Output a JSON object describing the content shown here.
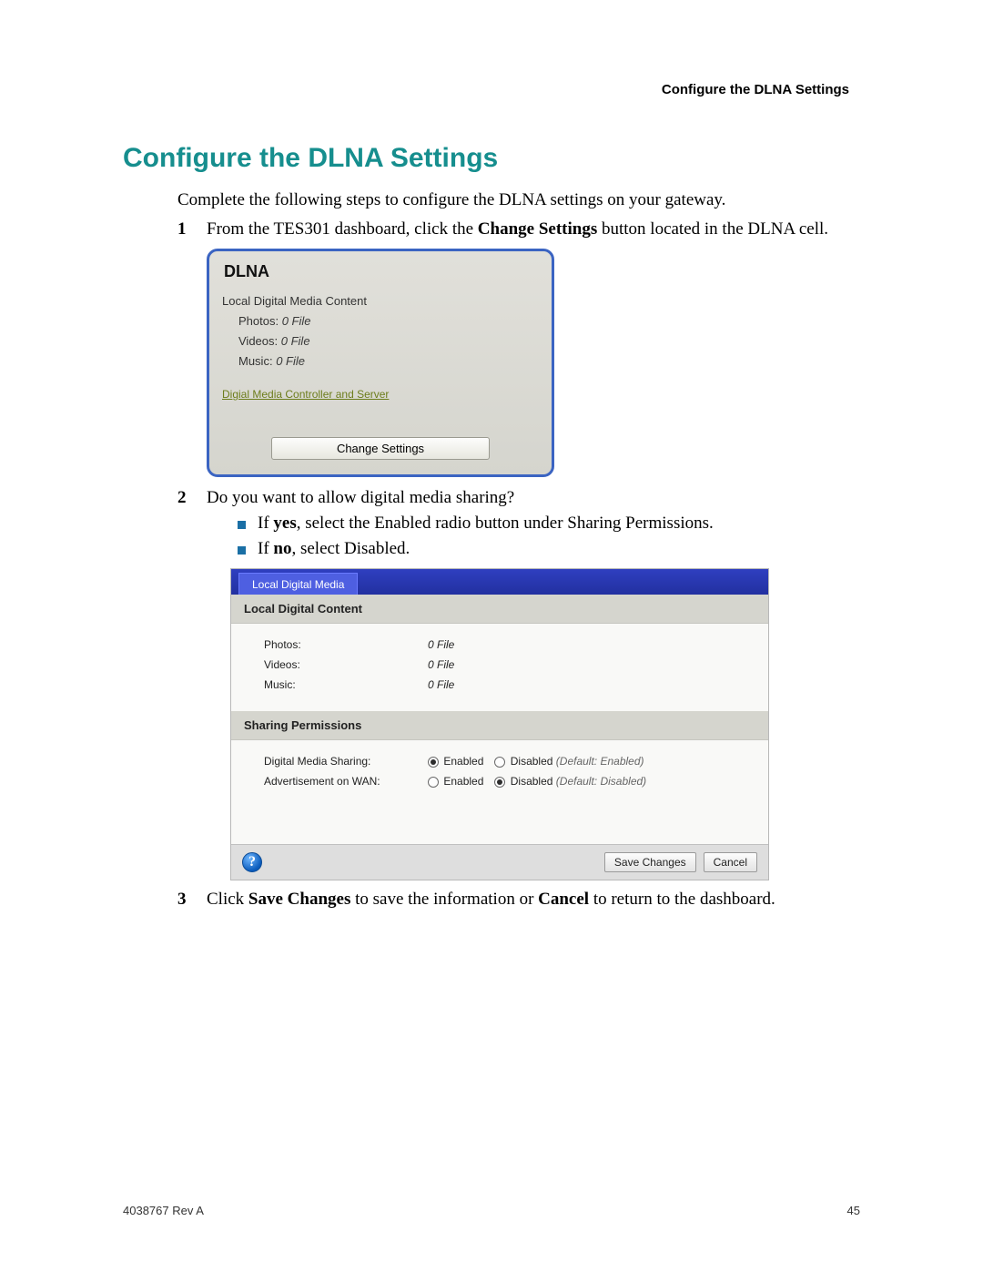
{
  "header": {
    "running": "Configure the DLNA Settings"
  },
  "title": "Configure the DLNA Settings",
  "intro": "Complete the following steps to configure the DLNA settings on your gateway.",
  "steps": {
    "s1a": "From the TES301 dashboard, click the ",
    "s1b": "Change Settings",
    "s1c": " button located in the DLNA cell.",
    "s2": "Do you want to allow digital media sharing?",
    "s2_yes_a": "If ",
    "s2_yes_b": "yes",
    "s2_yes_c": ", select the Enabled radio button under Sharing Permissions.",
    "s2_no_a": "If ",
    "s2_no_b": "no",
    "s2_no_c": ", select Disabled.",
    "s3a": "Click ",
    "s3b": "Save Changes",
    "s3c": " to save the information or ",
    "s3d": "Cancel",
    "s3e": " to return to the dashboard."
  },
  "card": {
    "title": "DLNA",
    "subtitle": "Local Digital Media Content",
    "rows": {
      "photos_label": "Photos:",
      "photos_value": "0 File",
      "videos_label": "Videos:",
      "videos_value": "0 File",
      "music_label": "Music:",
      "music_value": "0 File"
    },
    "link": "Digial Media Controller and Server",
    "button": "Change Settings"
  },
  "panel": {
    "tab": "Local Digital Media",
    "section1": "Local Digital Content",
    "content": {
      "photos_label": "Photos:",
      "photos_value": "0 File",
      "videos_label": "Videos:",
      "videos_value": "0 File",
      "music_label": "Music:",
      "music_value": "0 File"
    },
    "section2": "Sharing Permissions",
    "perm": {
      "dms_label": "Digital Media Sharing:",
      "wan_label": "Advertisement on WAN:",
      "enabled": "Enabled",
      "disabled": "Disabled",
      "default_enabled": "(Default: Enabled)",
      "default_disabled": "(Default: Disabled)"
    },
    "help": "?",
    "save": "Save Changes",
    "cancel": "Cancel"
  },
  "footer": {
    "left": "4038767 Rev A",
    "right": "45"
  }
}
